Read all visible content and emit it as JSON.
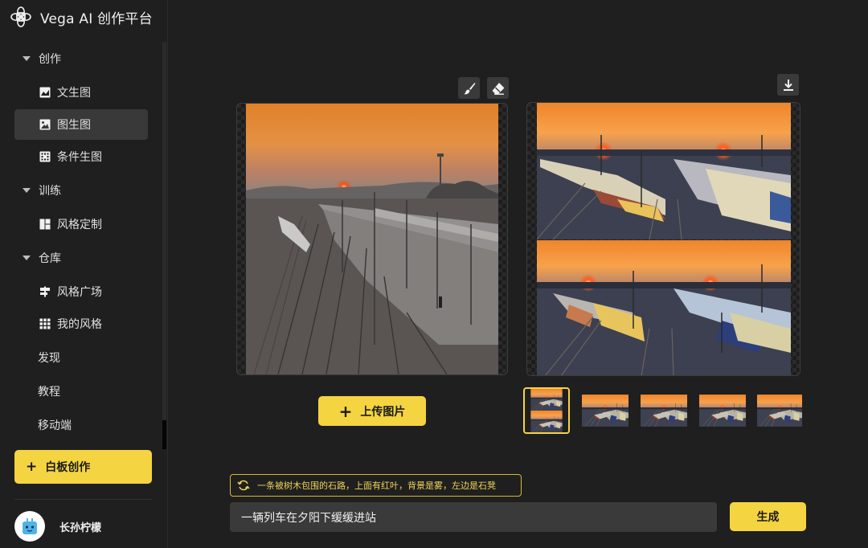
{
  "app": {
    "title": "Vega AI 创作平台"
  },
  "sidebar": {
    "groups": [
      {
        "label": "创作",
        "items": [
          {
            "label": "文生图"
          },
          {
            "label": "图生图",
            "active": true
          },
          {
            "label": "条件生图"
          }
        ]
      },
      {
        "label": "训练",
        "items": [
          {
            "label": "风格定制"
          }
        ]
      },
      {
        "label": "仓库",
        "items": [
          {
            "label": "风格广场"
          },
          {
            "label": "我的风格"
          }
        ]
      }
    ],
    "links": [
      {
        "label": "发现"
      },
      {
        "label": "教程"
      },
      {
        "label": "移动端"
      }
    ],
    "whiteboard_button": {
      "icon": "plus",
      "label": "白板创作"
    },
    "user": {
      "name": "长孙柠檬"
    }
  },
  "toolbar": {
    "icons": [
      "brush-icon",
      "eraser-icon",
      "download-icon"
    ]
  },
  "main": {
    "upload_button": {
      "icon": "plus",
      "label": "上传图片"
    },
    "suggestion": {
      "icon": "refresh-icon",
      "text": "一条被树木包围的石路，上面有红叶，背景是雾，左边是石凳"
    },
    "prompt": {
      "value": "一辆列车在夕阳下缓缓进站"
    },
    "generate_button": {
      "label": "生成"
    },
    "thumbnail_count": 5,
    "selected_thumbnail": 1
  },
  "colors": {
    "accent": "#f5d442",
    "background": "#1f1f1f",
    "panel": "#222222",
    "input": "#3a3a3a"
  }
}
